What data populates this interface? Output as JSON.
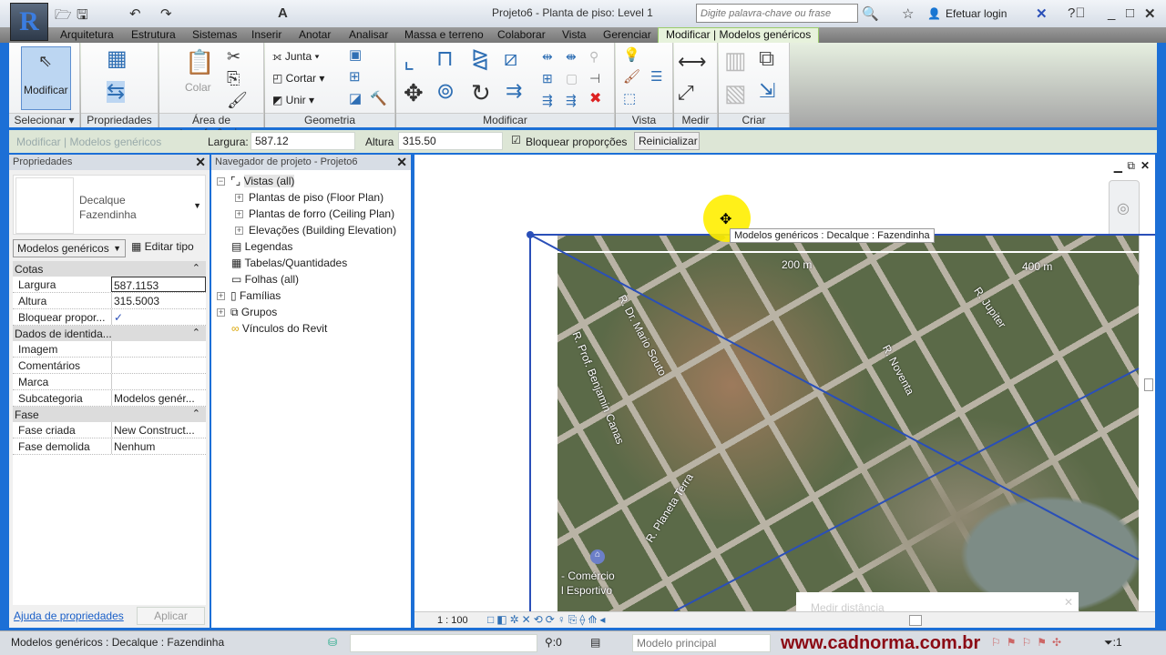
{
  "app": {
    "title": "Projeto6 - Planta de piso: Level 1",
    "search_placeholder": "Digite palavra-chave ou frase",
    "login": "Efetuar login",
    "logo": "R"
  },
  "tabs": [
    "Arquitetura",
    "Estrutura",
    "Sistemas",
    "Inserir",
    "Anotar",
    "Analisar",
    "Massa e terreno",
    "Colaborar",
    "Vista",
    "Gerenciar",
    "Modificar | Modelos genéricos"
  ],
  "ribbon": {
    "modificar": "Modificar",
    "colar": "Colar",
    "junta": "Junta",
    "cortar": "Cortar",
    "unir": "Unir",
    "panels": [
      "Selecionar ▾",
      "Propriedades",
      "Área de transferência",
      "Geometria",
      "Modificar",
      "Vista",
      "Medir",
      "Criar"
    ]
  },
  "options": {
    "context": "Modificar | Modelos genéricos",
    "largura_label": "Largura:",
    "largura": "587.12",
    "altura_label": "Altura",
    "altura": "315.50",
    "lock_label": "Bloquear proporções",
    "reset": "Reinicializar"
  },
  "properties": {
    "title": "Propriedades",
    "type_line1": "Decalque",
    "type_line2": "Fazendinha",
    "category": "Modelos genéricos",
    "edit_type": "Editar tipo",
    "groups": [
      {
        "name": "Cotas",
        "rows": [
          {
            "k": "Largura",
            "v": "587.1153"
          },
          {
            "k": "Altura",
            "v": "315.5003"
          },
          {
            "k": "Bloquear propor...",
            "v": "✓"
          }
        ]
      },
      {
        "name": "Dados de identida...",
        "rows": [
          {
            "k": "Imagem",
            "v": ""
          },
          {
            "k": "Comentários",
            "v": ""
          },
          {
            "k": "Marca",
            "v": ""
          },
          {
            "k": "Subcategoria",
            "v": "Modelos genér..."
          }
        ]
      },
      {
        "name": "Fase",
        "rows": [
          {
            "k": "Fase criada",
            "v": "New Construct..."
          },
          {
            "k": "Fase demolida",
            "v": "Nenhum"
          }
        ]
      }
    ],
    "help": "Ajuda de propriedades",
    "apply": "Aplicar"
  },
  "browser": {
    "title": "Navegador de projeto - Projeto6",
    "items": [
      "Vistas (all)",
      "Plantas de piso (Floor Plan)",
      "Plantas de forro (Ceiling Plan)",
      "Elevações (Building Elevation)",
      "Legendas",
      "Tabelas/Quantidades",
      "Folhas (all)",
      "Famílias",
      "Grupos",
      "Vínculos do Revit"
    ]
  },
  "canvas": {
    "tooltip": "Modelos genéricos : Decalque : Fazendinha",
    "scale": "1 : 100",
    "scale_200": "200 m",
    "scale_400": "400 m",
    "streets": [
      "R. Dr. Mario Souto",
      "R. Prof. Benjamin Canas",
      "R. Planeta Terra",
      "R. Noventa",
      "R. Jupiter"
    ],
    "poi_1": "- Comércio",
    "poi_2": "l Esportivo",
    "measure": "Medir distância"
  },
  "status": {
    "text": "Modelos genéricos : Decalque : Fazendinha",
    "count": ":0",
    "model": "Modelo principal",
    "watermark": "www.cadnorma.com.br",
    "filter": ":1"
  },
  "colors": {
    "accent": "#1c6fd6",
    "selection": "#2a4fb8",
    "watermark": "#8b0a14"
  }
}
